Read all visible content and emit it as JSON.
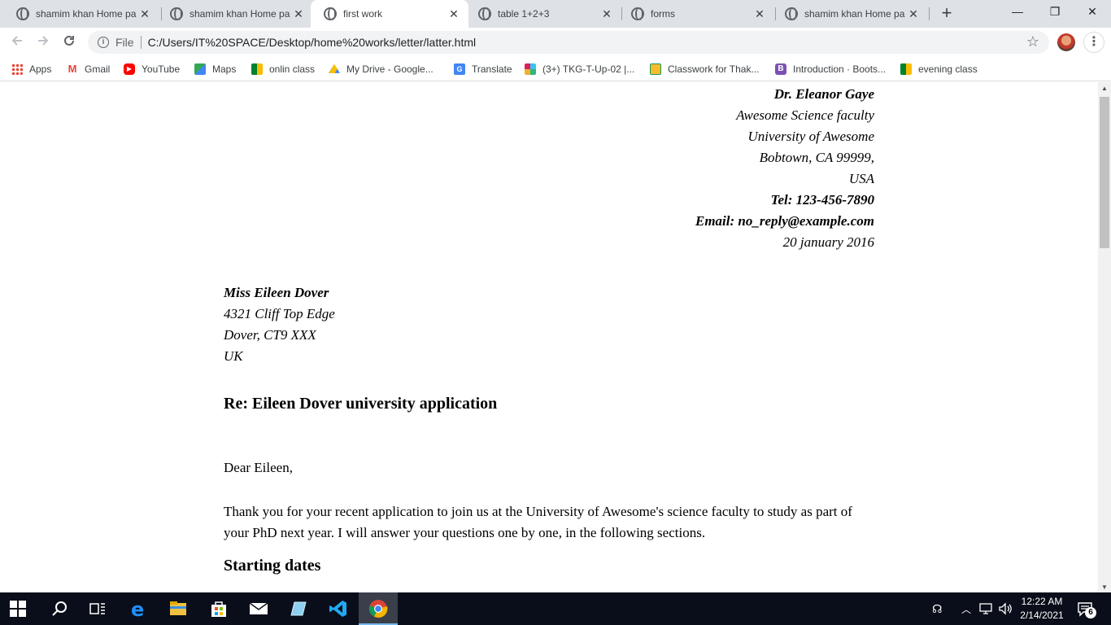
{
  "tabs": [
    {
      "title": "shamim khan Home pa",
      "active": false
    },
    {
      "title": "shamim khan Home pa",
      "active": false
    },
    {
      "title": "first work",
      "active": true
    },
    {
      "title": "table 1+2+3",
      "active": false
    },
    {
      "title": "forms",
      "active": false
    },
    {
      "title": "shamim khan Home pa",
      "active": false
    }
  ],
  "window_controls": {
    "minimize": "—",
    "restore": "❐",
    "close": "✕"
  },
  "toolbar": {
    "scheme": "File",
    "url": "C:/Users/IT%20SPACE/Desktop/home%20works/letter/latter.html"
  },
  "bookmarks": [
    {
      "label": "Apps",
      "icon": "apps-grid-icon"
    },
    {
      "label": "Gmail",
      "icon": "gmail-icon"
    },
    {
      "label": "YouTube",
      "icon": "youtube-icon"
    },
    {
      "label": "Maps",
      "icon": "maps-icon"
    },
    {
      "label": "onlin class",
      "icon": "meet-icon"
    },
    {
      "label": "My Drive - Google...",
      "icon": "drive-icon"
    },
    {
      "label": "Translate",
      "icon": "translate-icon"
    },
    {
      "label": "(3+) TKG-T-Up-02 |...",
      "icon": "slack-icon"
    },
    {
      "label": "Classwork for Thak...",
      "icon": "classroom-icon"
    },
    {
      "label": "Introduction · Boots...",
      "icon": "bootstrap-icon"
    },
    {
      "label": "evening class",
      "icon": "meet-icon"
    }
  ],
  "letter": {
    "sender_name": "Dr. Eleanor Gaye",
    "sender_lines": [
      "Awesome Science faculty",
      "University of Awesome",
      "Bobtown, CA 99999,",
      "USA"
    ],
    "tel": "Tel: 123-456-7890",
    "email": "Email: no_reply@example.com",
    "date": "20 january 2016",
    "recipient_name": "Miss Eileen Dover",
    "recipient_lines": [
      "4321 Cliff Top Edge",
      "Dover, CT9 XXX",
      "UK"
    ],
    "subject": "Re: Eileen Dover university application",
    "greeting": "Dear Eileen,",
    "paragraph": "Thank you for your recent application to join us at the University of Awesome's science faculty to study as part of your PhD next year. I will answer your questions one by one, in the following sections.",
    "section_heading": "Starting dates"
  },
  "taskbar": {
    "time": "12:22 AM",
    "date": "2/14/2021",
    "notifications": "6"
  }
}
